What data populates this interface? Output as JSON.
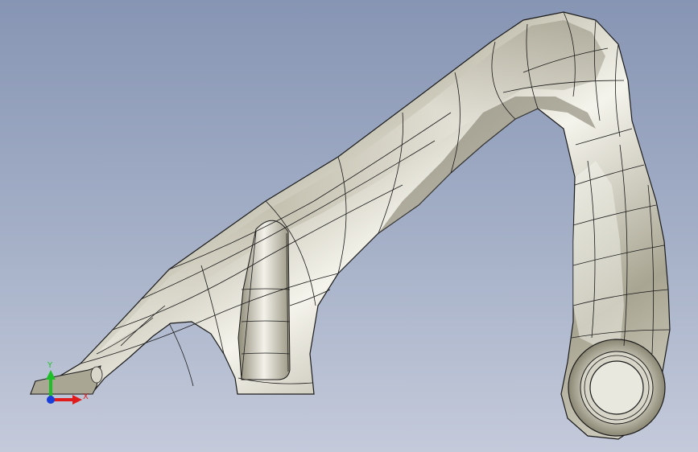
{
  "view": {
    "background_top": "#8795b4",
    "background_bottom": "#c4cada",
    "model_fill": "#c9c6b6",
    "model_highlight": "#f4f2ea",
    "model_shadow": "#77735f",
    "edge_color": "#1a1a1a"
  },
  "triad": {
    "x_label": "X",
    "y_label": "Y",
    "x_color": "#e01b1b",
    "y_color": "#1fbf2a",
    "z_color": "#1a3fd8"
  }
}
